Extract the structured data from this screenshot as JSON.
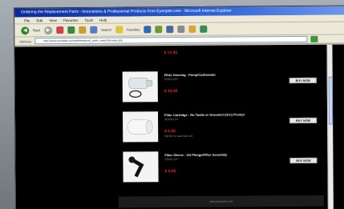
{
  "window": {
    "title": "Ordering the Replacement Parts - Innovations & Professional Products from Eyeopler.com - Microsoft Internet Explorer"
  },
  "menubar": {
    "items": [
      "File",
      "Edit",
      "View",
      "Favorites",
      "Tools",
      "Help"
    ]
  },
  "toolbar": {
    "back_label": "Back",
    "search_label": "Search",
    "favorites_label": "Favorites"
  },
  "addressbar": {
    "label": "Address",
    "url": "http://www.eyeopler.com/addressbook_parts_searchbrowse.php"
  },
  "content": {
    "top_price": "$ 10.95",
    "products": [
      {
        "name": "Filter Housing - Pump/Carbonator",
        "sku": "SD0023/97",
        "price": "$ 19.95",
        "note": "",
        "buy_label": "BUY NOW"
      },
      {
        "name": "Filter Cartridge - No Tastle or Grommet (Grn) Prompt",
        "sku": "SD0021/57",
        "price": "$ 6.95",
        "note": "$ 8.95 for each set 1/4",
        "buy_label": "BUY NOW"
      },
      {
        "name": "Filter Sleeve - 3/4 Plunge/Filter Assembly",
        "sku": "SD0021/57",
        "price": "$ 9.95",
        "note": "",
        "buy_label": "BUY NOW"
      }
    ],
    "footer_text": "www.eyeopler.com"
  }
}
